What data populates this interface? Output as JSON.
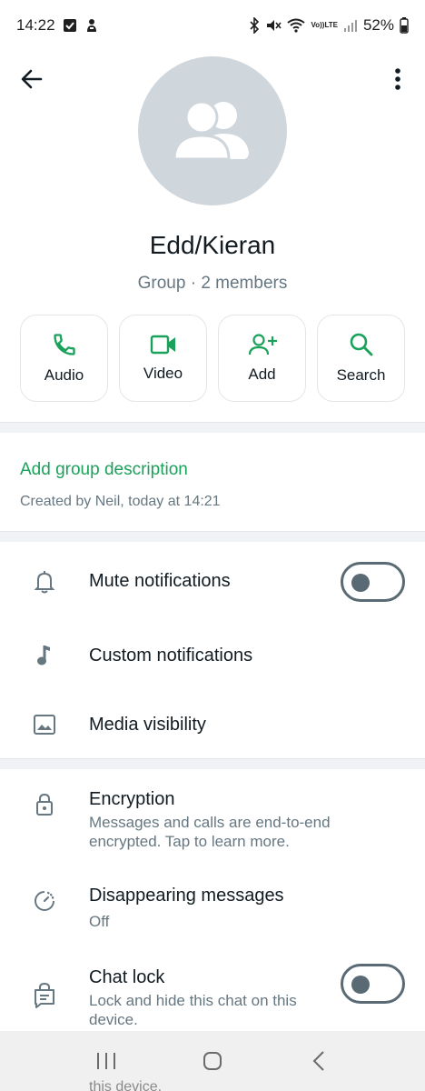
{
  "status_bar": {
    "time": "14:22",
    "battery": "52%",
    "volte_top": "Vo))",
    "volte_bottom": "LTE"
  },
  "header": {
    "group_name": "Edd/Kieran",
    "group_meta": "Group · 2 members",
    "actions": [
      {
        "label": "Audio",
        "icon": "phone-icon"
      },
      {
        "label": "Video",
        "icon": "video-icon"
      },
      {
        "label": "Add",
        "icon": "add-person-icon"
      },
      {
        "label": "Search",
        "icon": "search-icon"
      }
    ]
  },
  "description": {
    "add_label": "Add group description",
    "created": "Created by Neil, today at 14:21"
  },
  "notifications_section": {
    "mute": {
      "title": "Mute notifications",
      "toggle_on": false
    },
    "custom": {
      "title": "Custom notifications"
    },
    "media": {
      "title": "Media visibility"
    }
  },
  "privacy_section": {
    "encryption": {
      "title": "Encryption",
      "subtitle": "Messages and calls are end-to-end encrypted. Tap to learn more."
    },
    "disappearing": {
      "title": "Disappearing messages",
      "subtitle": "Off"
    },
    "chat_lock": {
      "title": "Chat lock",
      "subtitle": "Lock and hide this chat on this device.",
      "toggle_on": false
    }
  },
  "nav_bar": {
    "peek_text": "this device."
  },
  "colors": {
    "accent_green": "#1aa15a",
    "avatar_bg": "#cfd6dc",
    "secondary_text": "#667781",
    "divider_bg": "#f0f2f5"
  }
}
